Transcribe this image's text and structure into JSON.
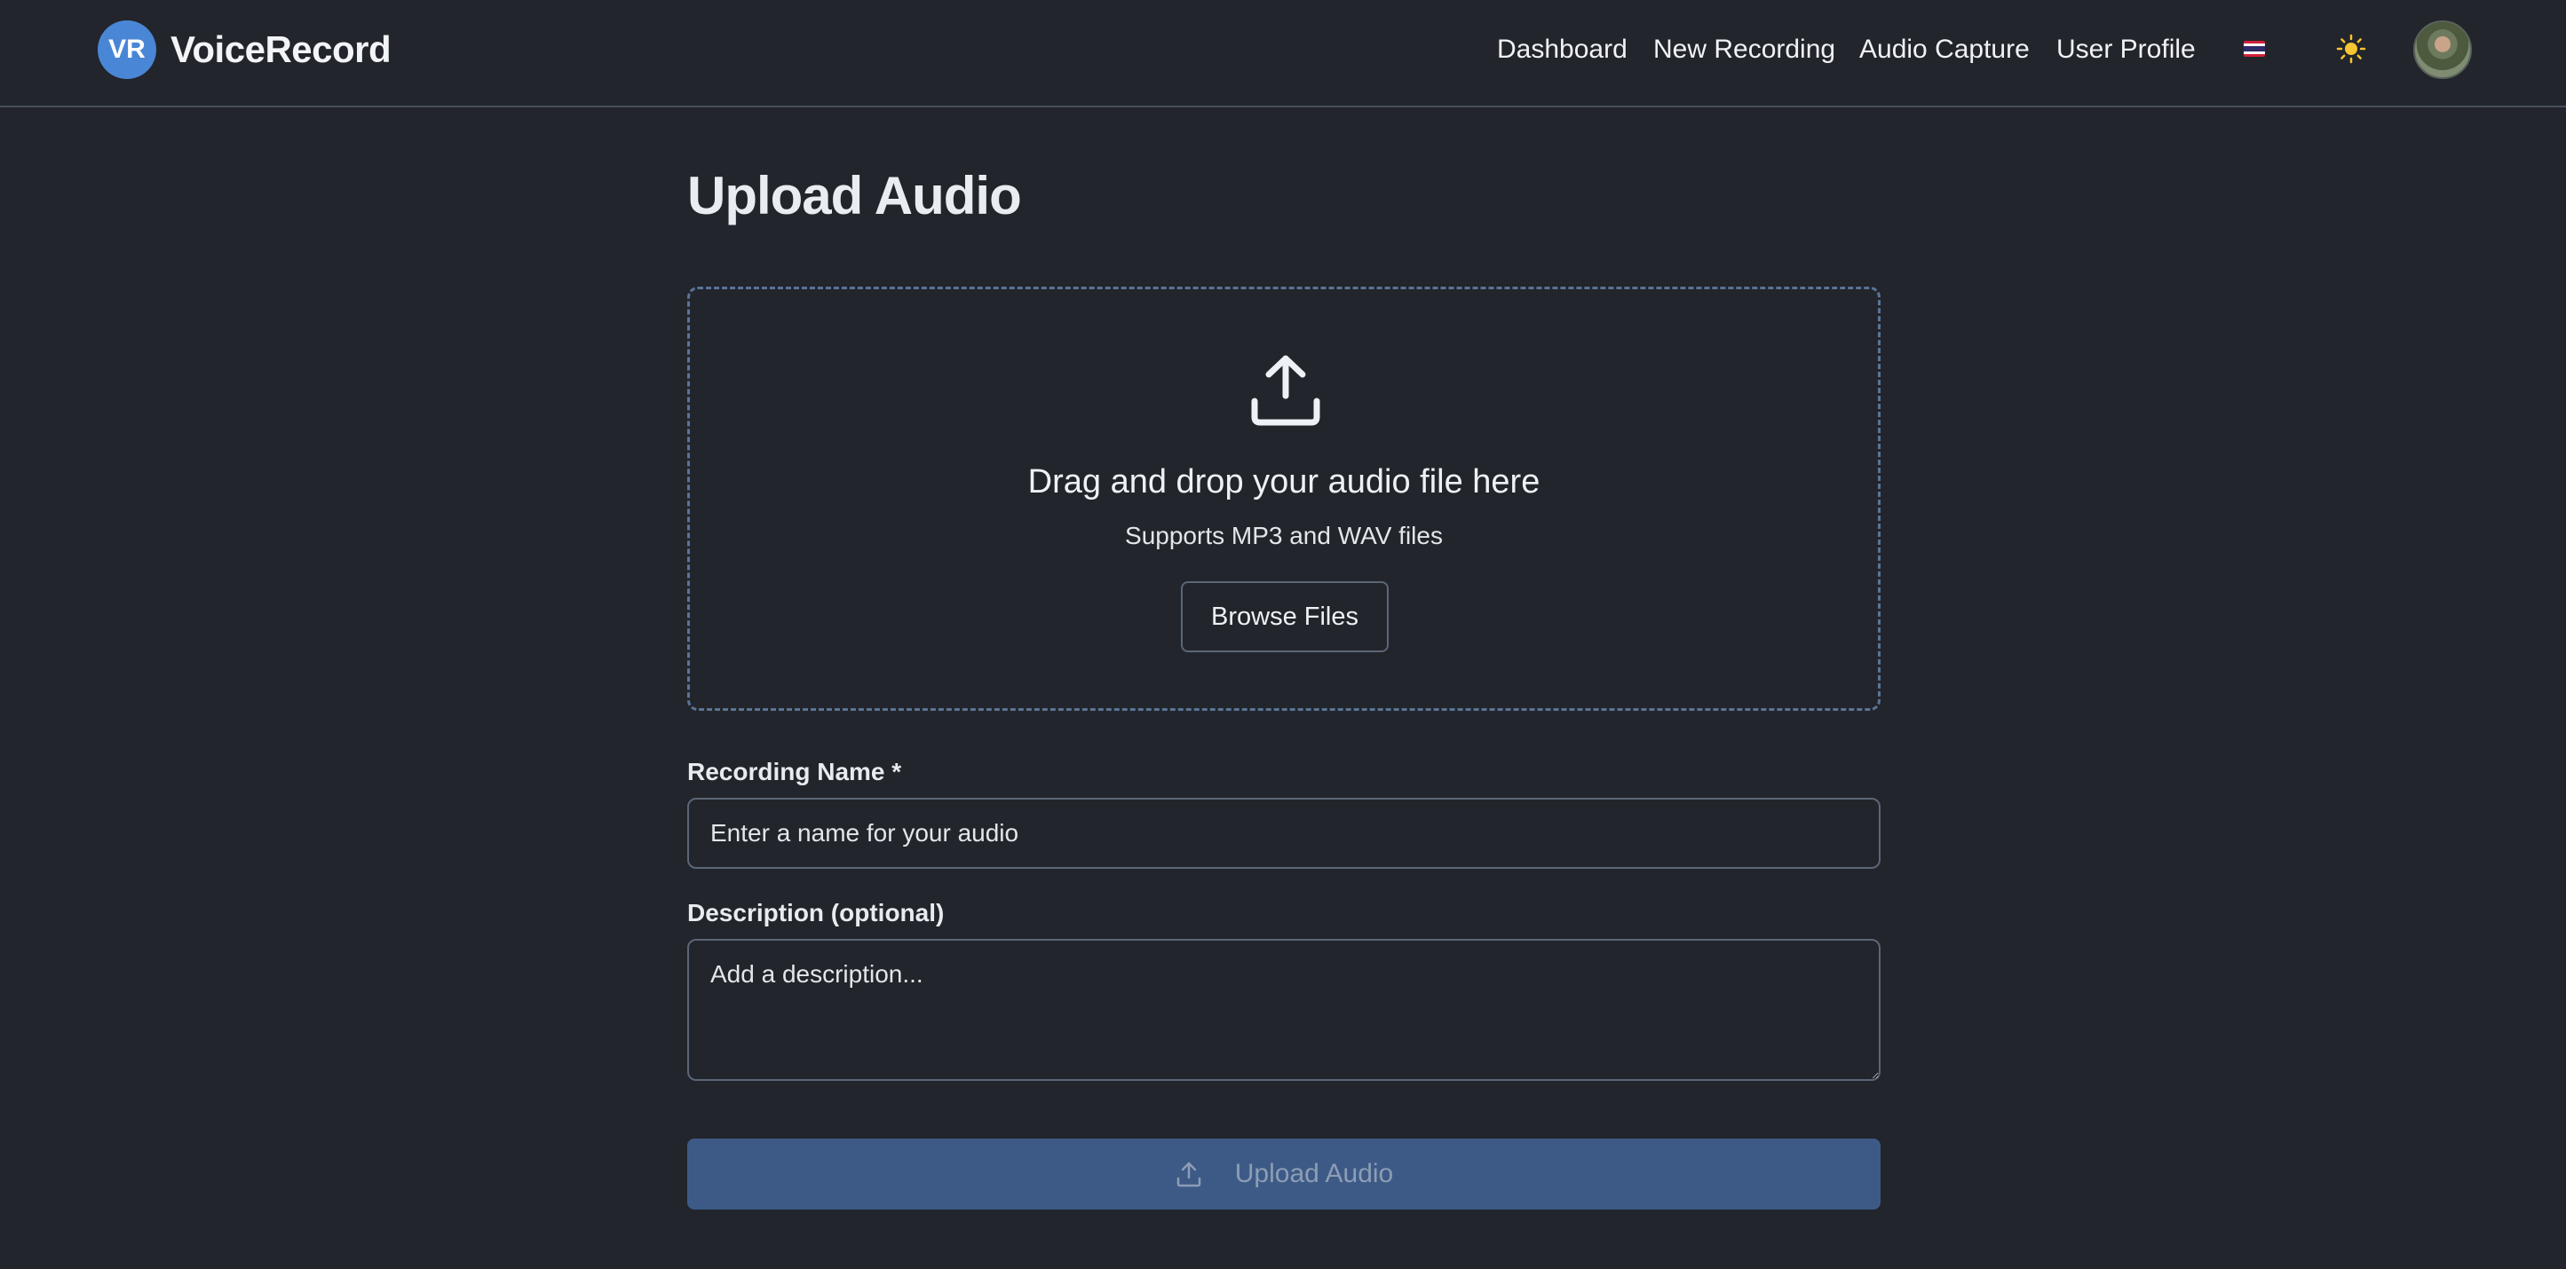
{
  "app": {
    "brand_initials": "VR",
    "brand_name": "VoiceRecord"
  },
  "nav": {
    "items": [
      {
        "label": "Dashboard"
      },
      {
        "label": "New Recording"
      },
      {
        "label": "Audio Capture"
      },
      {
        "label": "User Profile"
      }
    ],
    "language_flag": "thailand-flag-icon",
    "theme_toggle_icon": "sun-icon",
    "avatar": "user-avatar"
  },
  "page": {
    "title": "Upload Audio"
  },
  "dropzone": {
    "icon": "upload-icon",
    "title": "Drag and drop your audio file here",
    "subtitle": "Supports MP3 and WAV files",
    "browse_label": "Browse Files"
  },
  "form": {
    "name_label": "Recording Name *",
    "name_placeholder": "Enter a name for your audio",
    "name_value": "",
    "description_label": "Description (optional)",
    "description_placeholder": "Add a description...",
    "description_value": "",
    "submit_label": "Upload Audio",
    "submit_icon": "upload-icon",
    "submit_disabled": true
  },
  "colors": {
    "background": "#22252b",
    "brand_accent": "#4a86d6",
    "dropzone_border": "#5a7497",
    "submit_bg_disabled": "#3d5a87"
  }
}
